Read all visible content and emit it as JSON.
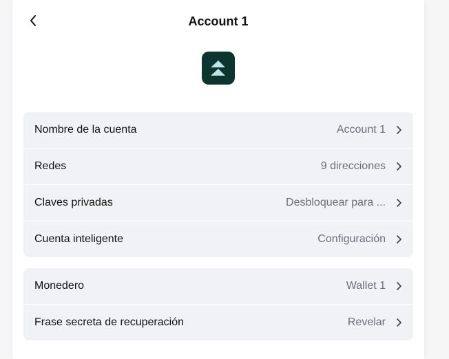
{
  "header": {
    "title": "Account 1"
  },
  "icons": {
    "back": "chevron-left-icon",
    "row_arrow": "chevron-right-icon",
    "avatar": "account-logo-icon"
  },
  "colors": {
    "avatar_bg": "#0d3530",
    "avatar_fg": "#bfe4e6",
    "row_bg": "#f1f2f6"
  },
  "account_group": {
    "rows": [
      {
        "label": "Nombre de la cuenta",
        "value": "Account 1"
      },
      {
        "label": "Redes",
        "value": "9 direcciones"
      },
      {
        "label": "Claves privadas",
        "value": "Desbloquear para ..."
      },
      {
        "label": "Cuenta inteligente",
        "value": "Configuración"
      }
    ]
  },
  "wallet_group": {
    "rows": [
      {
        "label": "Monedero",
        "value": "Wallet 1"
      },
      {
        "label": "Frase secreta de recuperación",
        "value": "Revelar"
      }
    ]
  }
}
